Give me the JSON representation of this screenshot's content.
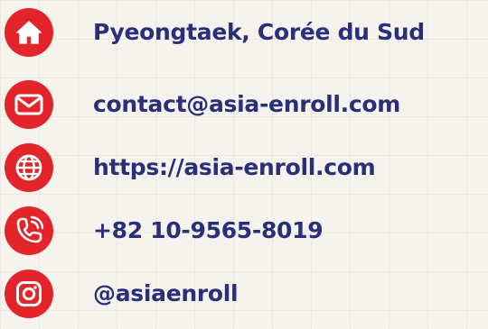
{
  "colors": {
    "accent": "#e3252b",
    "text": "#2a2f7a",
    "background": "#f6f2ee"
  },
  "contacts": [
    {
      "icon": "home-icon",
      "text": "Pyeongtaek, Corée du Sud"
    },
    {
      "icon": "mail-icon",
      "text": "contact@asia-enroll.com"
    },
    {
      "icon": "globe-icon",
      "text": "https://asia-enroll.com"
    },
    {
      "icon": "phone-icon",
      "text": "+82 10-9565-8019"
    },
    {
      "icon": "instagram-icon",
      "text": "@asiaenroll"
    }
  ]
}
